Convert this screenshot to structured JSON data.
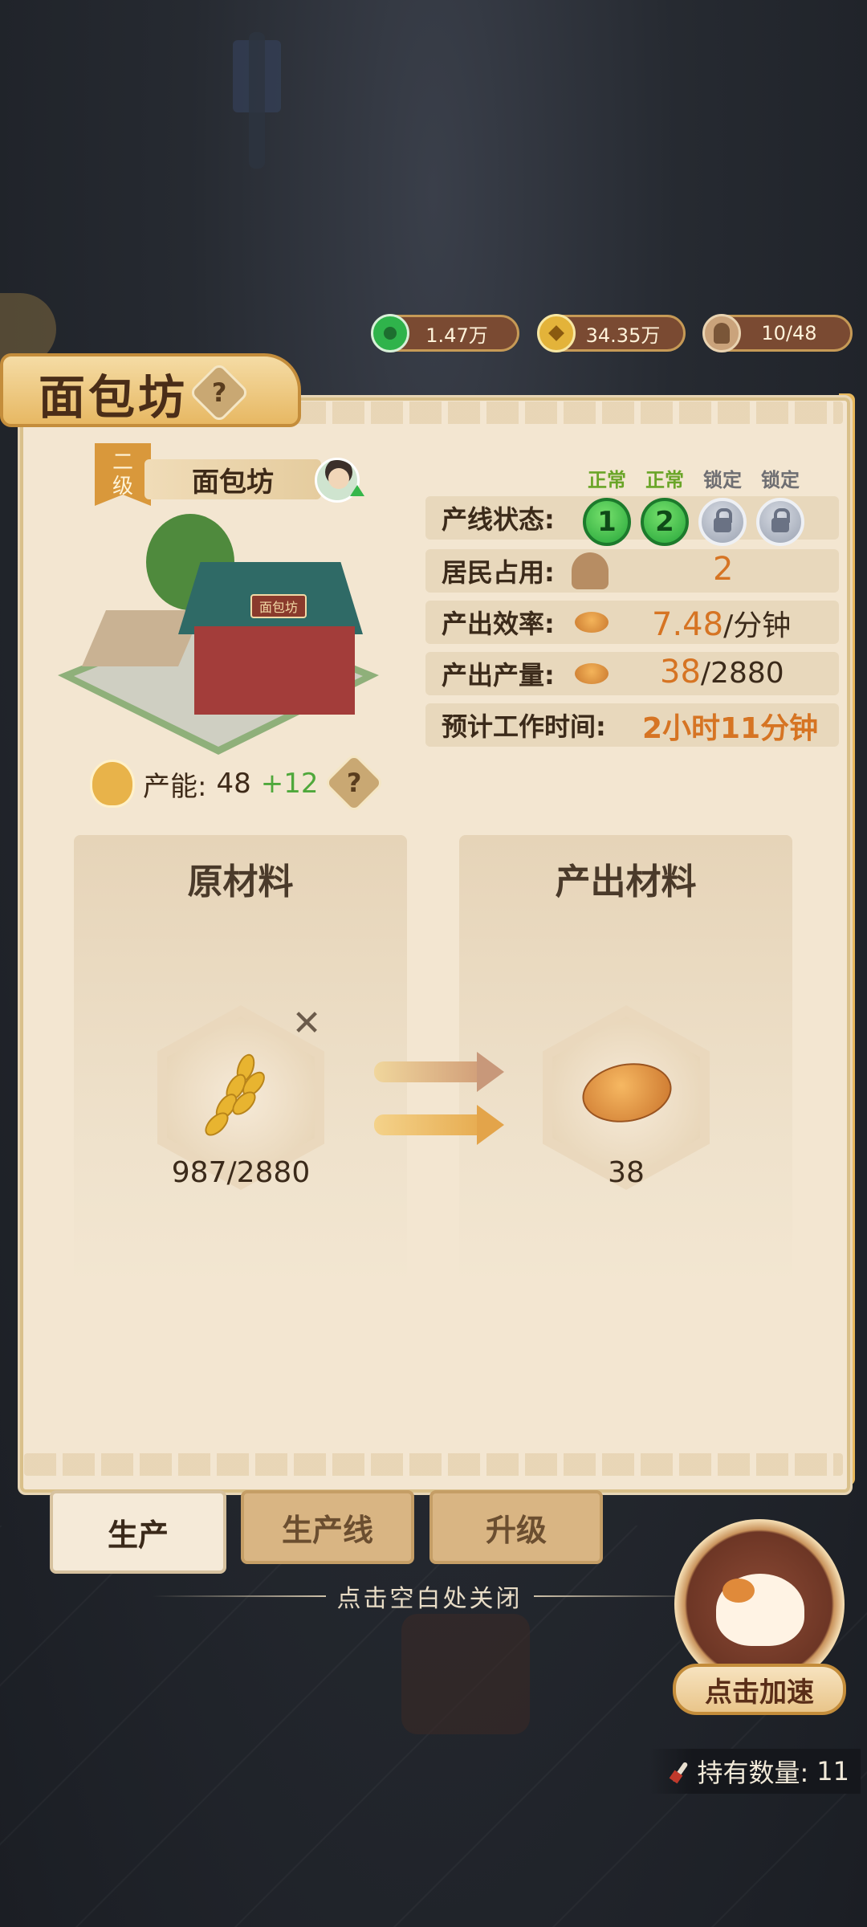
{
  "currency": {
    "jade": "1.47万",
    "coins": "34.35万",
    "workers": "10/48"
  },
  "panel": {
    "title": "面包坊",
    "help": "?"
  },
  "building": {
    "level": [
      "二",
      "级"
    ],
    "name": "面包坊",
    "sign": "面包坊",
    "capacity_label": "产能:",
    "capacity_value": "48",
    "capacity_bonus": "+12",
    "capacity_help": "?"
  },
  "status": {
    "line_state_label": "产线状态:",
    "slots": [
      {
        "state": "正常",
        "number": "1",
        "locked": false
      },
      {
        "state": "正常",
        "number": "2",
        "locked": false
      },
      {
        "state": "锁定",
        "number": "",
        "locked": true
      },
      {
        "state": "锁定",
        "number": "",
        "locked": true
      }
    ],
    "residents_label": "居民占用:",
    "residents_value": "2",
    "efficiency_label": "产出效率:",
    "efficiency_value": "7.48",
    "efficiency_unit": "/分钟",
    "output_label": "产出产量:",
    "output_current": "38",
    "output_max": "/2880",
    "time_label": "预计工作时间:",
    "time_value": "2小时11分钟"
  },
  "materials": {
    "raw_title": "原材料",
    "raw_icon": "wheat-icon",
    "raw_count": "987/2880",
    "remove": "✕",
    "output_title": "产出材料",
    "output_icon": "bread-icon",
    "output_count": "38"
  },
  "tabs": [
    {
      "label": "生产",
      "active": true
    },
    {
      "label": "生产线",
      "active": false
    },
    {
      "label": "升级",
      "active": false
    }
  ],
  "close_hint": "点击空白处关闭",
  "speed_up": {
    "label": "点击加速",
    "own_label": "持有数量:",
    "own_count": "11"
  },
  "colors": {
    "accent_orange": "#d67423",
    "status_green": "#6aa528",
    "parchment": "#f3e6d1"
  }
}
